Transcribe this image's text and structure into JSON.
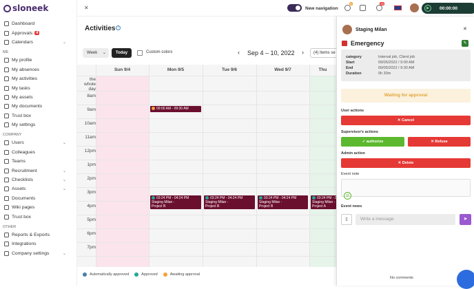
{
  "app": {
    "brand": "sloneek"
  },
  "sidebar": {
    "top": [
      {
        "label": "Dashboard",
        "icon": "dashboard-icon"
      },
      {
        "label": "Approvals",
        "badge": "4",
        "icon": "approvals-icon"
      },
      {
        "label": "Calendars",
        "chev": true,
        "icon": "calendar-icon"
      }
    ],
    "me_title": "ME",
    "me": [
      {
        "label": "My profile",
        "icon": "profile-icon"
      },
      {
        "label": "My absences",
        "icon": "absence-icon"
      },
      {
        "label": "My activities",
        "icon": "activity-icon"
      },
      {
        "label": "My tasks",
        "icon": "task-icon"
      },
      {
        "label": "My assets",
        "icon": "asset-icon"
      },
      {
        "label": "My documents",
        "icon": "document-icon"
      },
      {
        "label": "Trust box",
        "icon": "trust-icon"
      },
      {
        "label": "My settings",
        "icon": "settings-icon"
      }
    ],
    "company_title": "COMPANY",
    "company": [
      {
        "label": "Users",
        "chev": true,
        "icon": "users-icon"
      },
      {
        "label": "Colleagues",
        "icon": "colleagues-icon"
      },
      {
        "label": "Teams",
        "icon": "teams-icon"
      },
      {
        "label": "Recruitment",
        "chev": true,
        "icon": "recruit-icon"
      },
      {
        "label": "Checklists",
        "chev": true,
        "icon": "checklist-icon"
      },
      {
        "label": "Assets",
        "chev": true,
        "icon": "assets-icon"
      },
      {
        "label": "Documents",
        "icon": "docs-icon"
      },
      {
        "label": "Wiki pages",
        "icon": "wiki-icon"
      },
      {
        "label": "Trust box",
        "icon": "trust-icon"
      }
    ],
    "other_title": "OTHER",
    "other": [
      {
        "label": "Reports & Exports",
        "icon": "reports-icon"
      },
      {
        "label": "Integrations",
        "icon": "integrations-icon"
      },
      {
        "label": "Company settings",
        "chev": true,
        "icon": "company-settings-icon"
      }
    ]
  },
  "topbar": {
    "new_nav": "New navigation",
    "badge1": "0",
    "badge2": "16",
    "timer": "00:00:00"
  },
  "main": {
    "title": "Activities",
    "week_label": "Week",
    "today_label": "Today",
    "custom_colors": "Custom colors",
    "range": "Sep 4 – 10, 2022",
    "items_sel": "(4) Items se",
    "days": [
      "Sun 9/4",
      "Mon 9/5",
      "Tue 9/6",
      "Wed 9/7",
      "Thu"
    ],
    "allday": "the whole day",
    "hours": [
      "8am",
      "9am",
      "10am",
      "11am",
      "12pm",
      "1pm",
      "2pm",
      "3pm",
      "4pm",
      "5pm",
      "6pm",
      "7pm"
    ],
    "event_morning": "09:00 AM - 09:30 AM",
    "event_time": "03:24 PM - 04:24 PM",
    "event_name": "Staging Milan - ",
    "event_sub": "Project B",
    "event_sub_a": "Project A",
    "legend": [
      "Automatically approved",
      "Approved",
      "Awaiting approval"
    ]
  },
  "panel": {
    "user": "Staging Milan",
    "title": "Emergency",
    "labels": [
      "category",
      "Start",
      "End",
      "Duration"
    ],
    "values": [
      "Internal job, Client job",
      "09/05/2022 / 9:00 AM",
      "09/05/2022 / 9:30 AM",
      "0h 30m"
    ],
    "waiting": "Waiting for approval",
    "user_actions": "User actions",
    "cancel": "Cancel",
    "supervisor_actions": "Supervisor's actions",
    "authorize": "authorize",
    "refuse": "Refuse",
    "admin_action": "Admin action",
    "delete": "Delete",
    "event_note": "Event note",
    "event_news": "Event news",
    "placeholder": "Write a message",
    "no_comments": "No comments"
  },
  "colors": {
    "brand": "#4a2c6f",
    "event": "#6b0f2f",
    "red": "#e53935",
    "green": "#5cb82e"
  }
}
